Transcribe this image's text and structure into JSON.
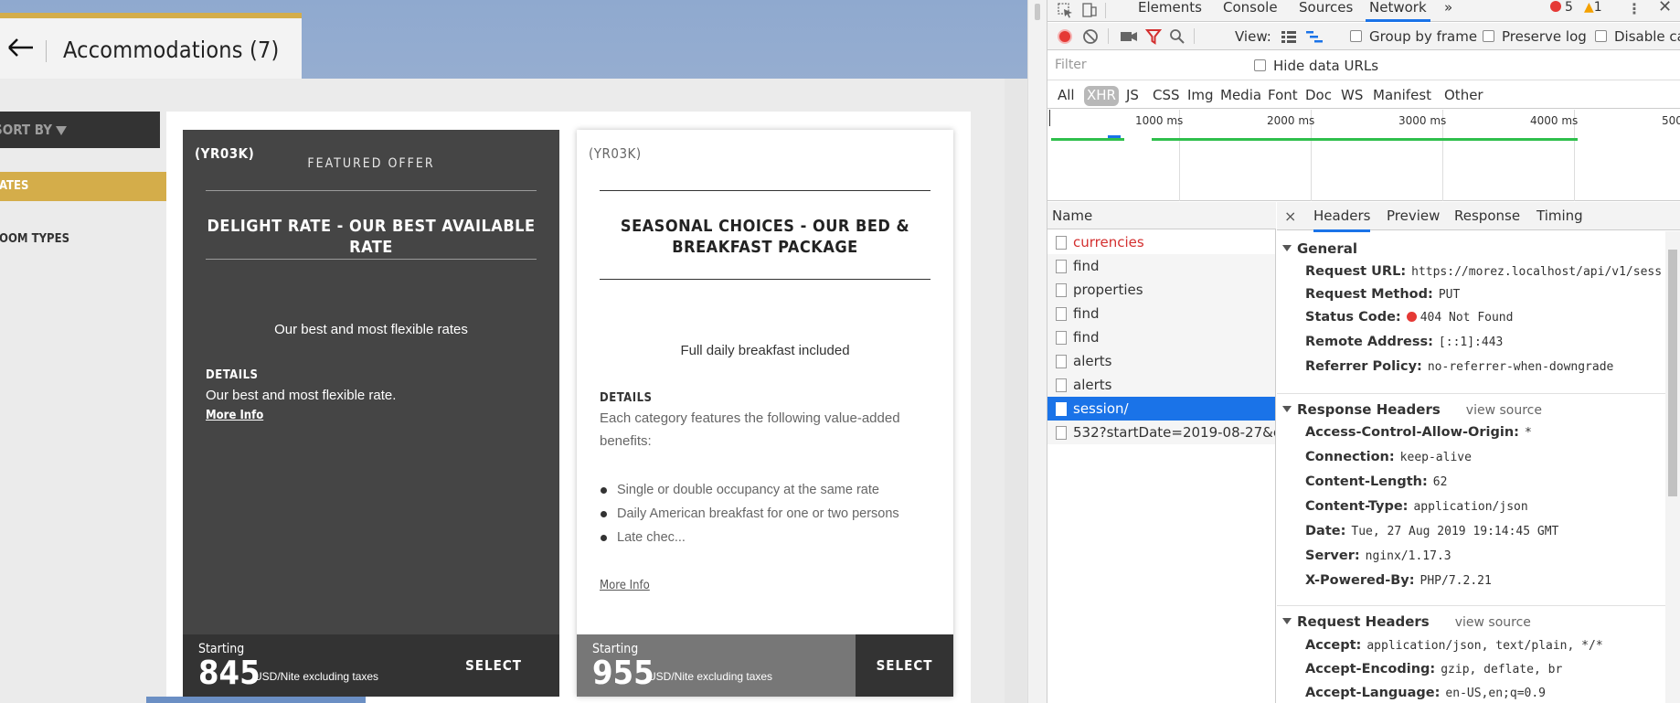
{
  "site": {
    "header": {
      "title": "Accommodations (7)"
    },
    "sidebar": {
      "sort_by": "SORT BY",
      "rates": "RATES",
      "room_types": "ROOM TYPES"
    },
    "cards": [
      {
        "code": "(YR03K)",
        "badge": "FEATURED OFFER",
        "title": "DELIGHT RATE - OUR BEST AVAILABLE RATE",
        "summary": "Our best and most flexible rates",
        "details_label": "DETAILS",
        "details_text": "Our best and most flexible rate.",
        "more_info": "More Info",
        "starting": "Starting",
        "price": "845",
        "unit": "USD/Nite excluding taxes",
        "select": "SELECT"
      },
      {
        "code": "(YR03K)",
        "title": "SEASONAL CHOICES - OUR BED & BREAKFAST PACKAGE",
        "summary": "Full daily breakfast included",
        "details_label": "DETAILS",
        "details_text": "Each category features the following value-added benefits:",
        "benefits": [
          "Single or double occupancy at the same rate",
          "Daily American breakfast for one or two persons",
          "Late chec..."
        ],
        "more_info": "More Info",
        "starting": "Starting",
        "price": "955",
        "unit": "USD/Nite excluding taxes",
        "select": "SELECT"
      }
    ],
    "colors": {
      "accent": "#d4ad4a",
      "dark_card": "#454545",
      "footer_dark": "#333333"
    }
  },
  "devtools": {
    "tabs": [
      "Elements",
      "Console",
      "Sources",
      "Network"
    ],
    "active_tab": "Network",
    "more_tabs": "»",
    "errors": "5",
    "warnings": "1",
    "toolbar": {
      "view_label": "View:",
      "group_by_frame": "Group by frame",
      "preserve_log": "Preserve log",
      "disable_cache": "Disable cac"
    },
    "filter": {
      "placeholder": "Filter",
      "hide_data_urls": "Hide data URLs"
    },
    "types": [
      "All",
      "XHR",
      "JS",
      "CSS",
      "Img",
      "Media",
      "Font",
      "Doc",
      "WS",
      "Manifest",
      "Other"
    ],
    "active_type": "XHR",
    "timeline": {
      "labels": [
        "1000 ms",
        "2000 ms",
        "3000 ms",
        "4000 ms",
        "500"
      ]
    },
    "requests": {
      "header": "Name",
      "items": [
        "currencies",
        "find",
        "properties",
        "find",
        "find",
        "alerts",
        "alerts",
        "session/",
        "532?startDate=2019-08-27&e..."
      ],
      "error_item": "currencies",
      "selected_item": "session/"
    },
    "detail": {
      "close": "×",
      "tabs": [
        "Headers",
        "Preview",
        "Response",
        "Timing"
      ],
      "active_tab": "Headers",
      "general": {
        "title": "General",
        "request_url_k": "Request URL:",
        "request_url_v": "https://morez.localhost/api/v1/sess",
        "method_k": "Request Method:",
        "method_v": "PUT",
        "status_k": "Status Code:",
        "status_v": "404 Not Found",
        "remote_k": "Remote Address:",
        "remote_v": "[::1]:443",
        "referrer_k": "Referrer Policy:",
        "referrer_v": "no-referrer-when-downgrade"
      },
      "response_headers": {
        "title": "Response Headers",
        "view_source": "view source",
        "acao_k": "Access-Control-Allow-Origin:",
        "acao_v": "*",
        "conn_k": "Connection:",
        "conn_v": "keep-alive",
        "len_k": "Content-Length:",
        "len_v": "62",
        "type_k": "Content-Type:",
        "type_v": "application/json",
        "date_k": "Date:",
        "date_v": "Tue, 27 Aug 2019 19:14:45 GMT",
        "server_k": "Server:",
        "server_v": "nginx/1.17.3",
        "xpb_k": "X-Powered-By:",
        "xpb_v": "PHP/7.2.21"
      },
      "request_headers": {
        "title": "Request Headers",
        "view_source": "view source",
        "accept_k": "Accept:",
        "accept_v": "application/json, text/plain, */*",
        "enc_k": "Accept-Encoding:",
        "enc_v": "gzip, deflate, br",
        "lang_k": "Accept-Language:",
        "lang_v": "en-US,en;q=0.9"
      }
    }
  }
}
